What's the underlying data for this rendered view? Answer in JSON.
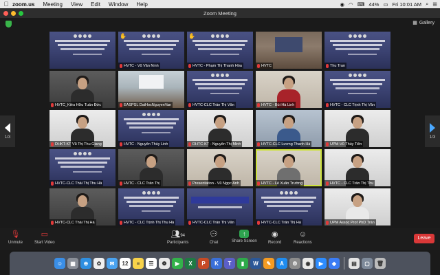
{
  "menubar": {
    "app_name": "zoom.us",
    "items": [
      "Meeting",
      "View",
      "Edit",
      "Window",
      "Help"
    ],
    "battery": "44%",
    "clock": "Fri 10:01 AM"
  },
  "window": {
    "title": "Zoom Meeting"
  },
  "gallery": {
    "label": "Gallery"
  },
  "pagination": {
    "left": "1/3",
    "right": "1/3"
  },
  "participants": [
    {
      "name": "",
      "kind": "slide",
      "raised": false
    },
    {
      "name": "HVTC - Vũ Văn Ninh",
      "kind": "slide",
      "raised": true
    },
    {
      "name": "HVTC - Phạm Thị Thanh Hòa",
      "kind": "slide",
      "raised": true
    },
    {
      "name": "HVTC",
      "kind": "room2",
      "raised": false
    },
    {
      "name": "Thu Tran",
      "kind": "slide",
      "raised": false
    },
    {
      "name": "HVTC_Kiều Hữu Tuấn Đức",
      "kind": "person-dark",
      "raised": false
    },
    {
      "name": "EASPSL DaiHocNguyenVan",
      "kind": "room",
      "raised": false
    },
    {
      "name": "HVTC-CLC Trần Thị Vân",
      "kind": "slide",
      "raised": false
    },
    {
      "name": "HVTC - Bùi Hà Linh",
      "kind": "person-red",
      "raised": false
    },
    {
      "name": "HVTC - CLC Trịnh Thị Vân",
      "kind": "slide",
      "raised": false
    },
    {
      "name": "DHKT-KT Vũ Thị Thu Giang",
      "kind": "person-light",
      "raised": false
    },
    {
      "name": "HVTC - Nguyễn Thùy Linh",
      "kind": "slide",
      "raised": false
    },
    {
      "name": "DHTC-KT - Nguyễn Thị Minh",
      "kind": "person-light",
      "raised": false
    },
    {
      "name": "HVTC-CLC Lương Thanh Hà",
      "kind": "person-blue",
      "raised": false
    },
    {
      "name": "UPM-Vũ Thủy Tiên",
      "kind": "person-light",
      "raised": false
    },
    {
      "name": "HVTC-CLC Thái Thị Thu Hà",
      "kind": "slide",
      "raised": false
    },
    {
      "name": "HVTC - CLC Trần Thị",
      "kind": "person-dark",
      "raised": false
    },
    {
      "name": "Presentation - Vũ Ngọc Anh",
      "kind": "person",
      "raised": false
    },
    {
      "name": "HVTC - Lê Xuân Trường",
      "kind": "person-grey",
      "raised": false,
      "active": true
    },
    {
      "name": "HVTC - CLC Trần Thị Thu",
      "kind": "person-light",
      "raised": false
    },
    {
      "name": "HVTC-CLC Thái Thị Hà",
      "kind": "person-dark",
      "raised": false
    },
    {
      "name": "HVTC - CLC Trịnh Thị Thu Hà",
      "kind": "slide",
      "raised": false
    },
    {
      "name": "HVTC-CLC Trần Thị Vân",
      "kind": "black-slide",
      "raised": false
    },
    {
      "name": "HVTC-CLC Trần Thị Hà",
      "kind": "slide",
      "raised": false
    },
    {
      "name": "UPM Assoc Prof PhD Trần",
      "kind": "person-white",
      "raised": false
    },
    {
      "name": "HVTC - CLC Trần Thị Thu",
      "kind": "person-light2",
      "raised": false
    }
  ],
  "toolbar": {
    "unmute": "Unmute",
    "start_video": "Start Video",
    "participants": "Participants",
    "participants_count": "94",
    "chat": "Chat",
    "share_screen": "Share Screen",
    "record": "Record",
    "reactions": "Reactions",
    "leave": "Leave"
  },
  "dock": {
    "apps": [
      {
        "icon": "finder-icon",
        "color": "#3a8ee6",
        "glyph": "☺"
      },
      {
        "icon": "launchpad-icon",
        "color": "#8a8f98",
        "glyph": "▦"
      },
      {
        "icon": "safari-icon",
        "color": "#2f8fe0",
        "glyph": "⊕"
      },
      {
        "icon": "photos-icon",
        "color": "#f0f0f0",
        "glyph": "✿"
      },
      {
        "icon": "mail-icon",
        "color": "#4aa3f0",
        "glyph": "✉"
      },
      {
        "icon": "calendar-icon",
        "color": "#ffffff",
        "glyph": "12"
      },
      {
        "icon": "notes-icon",
        "color": "#f7d24a",
        "glyph": "≡"
      },
      {
        "icon": "reminders-icon",
        "color": "#ffffff",
        "glyph": "☰"
      },
      {
        "icon": "photos2-icon",
        "color": "#e8e8e8",
        "glyph": "❁"
      },
      {
        "icon": "facetime-icon",
        "color": "#33b24a",
        "glyph": "▶"
      },
      {
        "icon": "excel-icon",
        "color": "#1f7a43",
        "glyph": "X"
      },
      {
        "icon": "powerpoint-icon",
        "color": "#c64a25",
        "glyph": "P"
      },
      {
        "icon": "keynote-icon",
        "color": "#3a6fd8",
        "glyph": "K"
      },
      {
        "icon": "teams-icon",
        "color": "#5b5fc7",
        "glyph": "T"
      },
      {
        "icon": "numbers-icon",
        "color": "#2eaa4a",
        "glyph": "▮"
      },
      {
        "icon": "word-icon",
        "color": "#2b5797",
        "glyph": "W"
      },
      {
        "icon": "pages-icon",
        "color": "#f59b22",
        "glyph": "✎"
      },
      {
        "icon": "appstore-icon",
        "color": "#1f8cf0",
        "glyph": "A"
      },
      {
        "icon": "settings-icon",
        "color": "#8c8c8c",
        "glyph": "⚙"
      },
      {
        "icon": "chrome-icon",
        "color": "#e9e9e9",
        "glyph": "◉"
      },
      {
        "icon": "zoom-icon",
        "color": "#2d8cff",
        "glyph": "▶"
      },
      {
        "icon": "messenger-icon",
        "color": "#3b7cf5",
        "glyph": "◆"
      },
      {
        "icon": "skype-icon",
        "color": "#e4e4e4",
        "glyph": "▤"
      },
      {
        "icon": "downloads-icon",
        "color": "#7e8a9a",
        "glyph": "▢"
      },
      {
        "icon": "trash-icon",
        "color": "#bcbcbc",
        "glyph": "🗑"
      }
    ]
  }
}
